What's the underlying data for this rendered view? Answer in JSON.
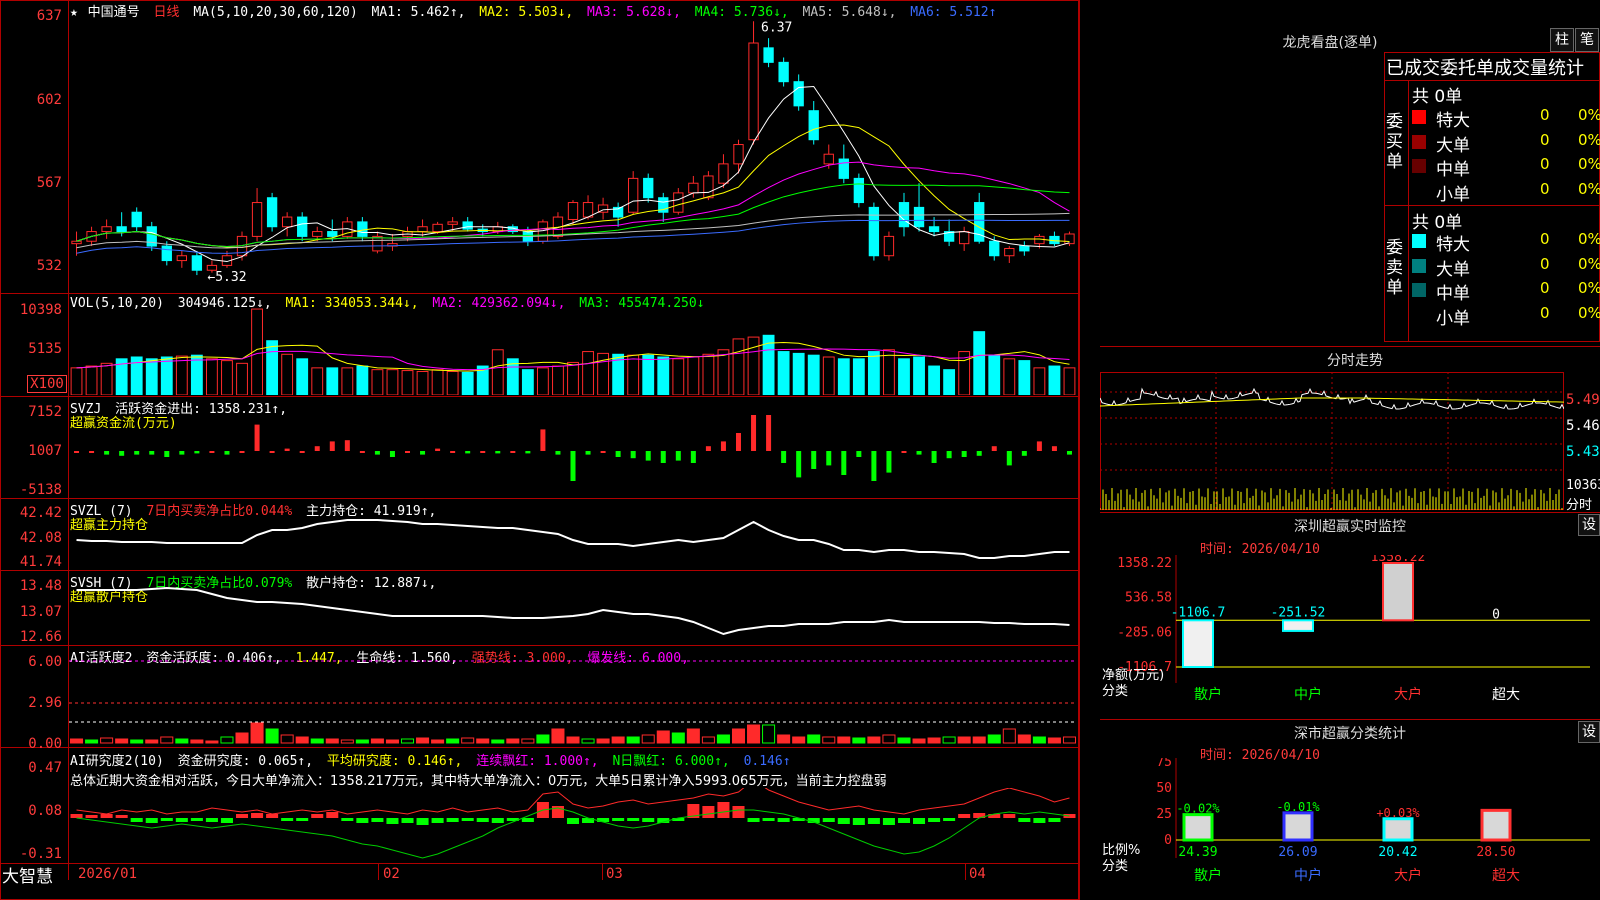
{
  "colors": {
    "up": "#ff2a2a",
    "down": "#00ffff",
    "grid": "#b00000",
    "ma1": "#ffffff",
    "ma2": "#ffff00",
    "ma3": "#ff00ff",
    "ma4": "#00ff00",
    "ma5": "#c0c0c0",
    "ma6": "#3a6bff"
  },
  "app": {
    "brand": "大智慧"
  },
  "main": {
    "star": "★",
    "title": "中国通号",
    "period": "日线",
    "ma_label": "MA(5,10,20,30,60,120)",
    "ma1": "MA1: 5.462↑,",
    "ma2": "MA2: 5.503↓,",
    "ma3": "MA3: 5.628↓,",
    "ma4": "MA4: 5.736↓,",
    "ma5": "MA5: 5.648↓,",
    "ma6": "MA6: 5.512↑",
    "y_ticks": [
      "637",
      "602",
      "567",
      "532"
    ],
    "high_mark": "6.37",
    "low_mark": "←5.32"
  },
  "vol": {
    "label": "VOL(5,10,20)",
    "val": "304946.125↓,",
    "ma1": "MA1: 334053.344↓,",
    "ma2": "MA2: 429362.094↓,",
    "ma3": "MA3: 455474.250↓",
    "y_ticks": [
      "10398",
      "5135"
    ],
    "unit": "X100"
  },
  "svzj": {
    "label": "SVZJ",
    "text": "活跃资金进出: 1358.231↑,",
    "sub": "超赢资金流(万元)",
    "y_ticks": [
      "7152",
      "1007",
      "-5138"
    ]
  },
  "svzl": {
    "label": "SVZL (7)",
    "red_text": "7日内买卖净占比0.044%",
    "text": "主力持仓: 41.919↑,",
    "sub": "超赢主力持仓",
    "y_ticks": [
      "42.42",
      "42.08",
      "41.74"
    ]
  },
  "svsh": {
    "label": "SVSH (7)",
    "green_text": "7日内买卖净占比0.079%",
    "text": "散户持仓: 12.887↓,",
    "sub": "超赢散户持仓",
    "y_ticks": [
      "13.48",
      "13.07",
      "12.66"
    ]
  },
  "ai1": {
    "label": "AI活跃度2",
    "t1": "资金活跃度: 0.406↑,",
    "t2": "1.447,",
    "t3": "生命线: 1.560,",
    "t4": "强势线: 3.000,",
    "t5": "爆发线: 6.000,",
    "y_ticks": [
      "6.00",
      "2.96",
      "0.00"
    ]
  },
  "ai2": {
    "label": "AI研究度2(10)",
    "t1": "资金研究度: 0.065↑,",
    "t2": "平均研究度: 0.146↑,",
    "t3": "连续飘红: 1.000↑,",
    "t4": "N日飘红: 6.000↑,",
    "t5": "0.146↑",
    "summary": "总体近期大资金相对活跃，今日大单净流入：1358.217万元，其中特大单净流入：0万元，大单5日累计净入5993.065万元，当前主力控盘弱",
    "y_ticks": [
      "0.47",
      "0.08",
      "-0.31"
    ]
  },
  "x_axis": [
    "2026/01",
    "02",
    "03",
    "04"
  ],
  "lhb": {
    "title": "龙虎看盘(逐单)",
    "btn1": "柱",
    "btn2": "笔",
    "header": "已成交委托单成交量统计",
    "buy": {
      "side": "委买单",
      "total": "共 0单",
      "rows": [
        {
          "name": "特大",
          "v": "0",
          "p": "0%"
        },
        {
          "name": "大单",
          "v": "0",
          "p": "0%"
        },
        {
          "name": "中单",
          "v": "0",
          "p": "0%"
        },
        {
          "name": "小单",
          "v": "0",
          "p": "0%"
        }
      ]
    },
    "sell": {
      "side": "委卖单",
      "total": "共 0单",
      "rows": [
        {
          "name": "特大",
          "v": "0",
          "p": "0%"
        },
        {
          "name": "大单",
          "v": "0",
          "p": "0%"
        },
        {
          "name": "中单",
          "v": "0",
          "p": "0%"
        },
        {
          "name": "小单",
          "v": "0",
          "p": "0%"
        }
      ]
    }
  },
  "intraday": {
    "title": "分时走势",
    "y_ticks": [
      "5.49",
      "5.46",
      "5.43"
    ],
    "vol_top": "10363",
    "vol_unit": "分时"
  },
  "monitor": {
    "title": "深圳超赢实时监控",
    "btn": "设",
    "time": "时间: 2026/04/10",
    "y_ticks": [
      "1358.22",
      "536.58",
      "-285.06",
      "-1106.7"
    ],
    "y_label": "净额(万元)",
    "x_label": "分类",
    "categories": [
      "散户",
      "中户",
      "大户",
      "超大"
    ],
    "values": [
      -1106.7,
      -251.52,
      1358.22,
      0
    ],
    "value_labels": [
      "-1106.7",
      "-251.52",
      "1358.22",
      "0"
    ]
  },
  "classify": {
    "title": "深市超赢分类统计",
    "btn": "设",
    "time": "时间: 2026/04/10",
    "y_ticks": [
      "75",
      "50",
      "25",
      "0"
    ],
    "y_label": "比例%",
    "x_label": "分类",
    "categories": [
      "散户",
      "中户",
      "大户",
      "超大"
    ],
    "values": [
      24.39,
      26.09,
      20.42,
      28.5
    ],
    "value_labels": [
      "24.39",
      "26.09",
      "20.42",
      "28.50"
    ],
    "change_labels": [
      "-0.02%",
      "-0.01%",
      "+0.03%",
      ""
    ]
  },
  "chart_data": [
    {
      "type": "candlestick",
      "title": "中国通号 日线",
      "ylim": [
        5.25,
        6.4
      ],
      "x": [
        "2026/01",
        "02",
        "03",
        "04"
      ],
      "ohlc": [
        [
          5.45,
          5.5,
          5.4,
          5.46
        ],
        [
          5.46,
          5.52,
          5.44,
          5.5
        ],
        [
          5.5,
          5.55,
          5.47,
          5.52
        ],
        [
          5.52,
          5.58,
          5.48,
          5.5
        ],
        [
          5.58,
          5.6,
          5.5,
          5.52
        ],
        [
          5.52,
          5.54,
          5.42,
          5.44
        ],
        [
          5.44,
          5.46,
          5.36,
          5.38
        ],
        [
          5.38,
          5.42,
          5.35,
          5.4
        ],
        [
          5.4,
          5.42,
          5.32,
          5.34
        ],
        [
          5.34,
          5.38,
          5.33,
          5.36
        ],
        [
          5.36,
          5.42,
          5.35,
          5.4
        ],
        [
          5.4,
          5.5,
          5.38,
          5.48
        ],
        [
          5.48,
          5.68,
          5.46,
          5.62
        ],
        [
          5.64,
          5.66,
          5.5,
          5.52
        ],
        [
          5.52,
          5.58,
          5.48,
          5.56
        ],
        [
          5.56,
          5.58,
          5.46,
          5.48
        ],
        [
          5.48,
          5.52,
          5.46,
          5.5
        ],
        [
          5.5,
          5.55,
          5.46,
          5.48
        ],
        [
          5.48,
          5.56,
          5.47,
          5.54
        ],
        [
          5.54,
          5.56,
          5.46,
          5.48
        ],
        [
          5.42,
          5.5,
          5.41,
          5.48
        ],
        [
          5.44,
          5.49,
          5.42,
          5.45
        ],
        [
          5.48,
          5.52,
          5.46,
          5.5
        ],
        [
          5.5,
          5.55,
          5.48,
          5.52
        ],
        [
          5.5,
          5.54,
          5.49,
          5.53
        ],
        [
          5.53,
          5.56,
          5.5,
          5.54
        ],
        [
          5.54,
          5.56,
          5.5,
          5.51
        ],
        [
          5.51,
          5.53,
          5.48,
          5.5
        ],
        [
          5.5,
          5.54,
          5.49,
          5.52
        ],
        [
          5.52,
          5.53,
          5.49,
          5.5
        ],
        [
          5.5,
          5.52,
          5.44,
          5.46
        ],
        [
          5.46,
          5.55,
          5.45,
          5.54
        ],
        [
          5.48,
          5.58,
          5.47,
          5.56
        ],
        [
          5.55,
          5.63,
          5.53,
          5.62
        ],
        [
          5.56,
          5.65,
          5.55,
          5.62
        ],
        [
          5.58,
          5.64,
          5.55,
          5.61
        ],
        [
          5.6,
          5.62,
          5.52,
          5.56
        ],
        [
          5.58,
          5.75,
          5.57,
          5.72
        ],
        [
          5.72,
          5.74,
          5.62,
          5.64
        ],
        [
          5.64,
          5.66,
          5.54,
          5.58
        ],
        [
          5.58,
          5.68,
          5.57,
          5.66
        ],
        [
          5.66,
          5.73,
          5.64,
          5.7
        ],
        [
          5.64,
          5.75,
          5.63,
          5.73
        ],
        [
          5.7,
          5.82,
          5.68,
          5.78
        ],
        [
          5.78,
          5.88,
          5.74,
          5.86
        ],
        [
          5.88,
          6.37,
          5.86,
          6.28
        ],
        [
          6.26,
          6.3,
          6.18,
          6.2
        ],
        [
          6.2,
          6.22,
          6.1,
          6.12
        ],
        [
          6.12,
          6.15,
          6.0,
          6.02
        ],
        [
          6.0,
          6.04,
          5.86,
          5.88
        ],
        [
          5.78,
          5.86,
          5.76,
          5.82
        ],
        [
          5.8,
          5.86,
          5.7,
          5.72
        ],
        [
          5.72,
          5.74,
          5.6,
          5.62
        ],
        [
          5.6,
          5.62,
          5.38,
          5.4
        ],
        [
          5.4,
          5.5,
          5.38,
          5.48
        ],
        [
          5.62,
          5.66,
          5.48,
          5.52
        ],
        [
          5.6,
          5.7,
          5.5,
          5.52
        ],
        [
          5.52,
          5.56,
          5.48,
          5.5
        ],
        [
          5.5,
          5.55,
          5.44,
          5.46
        ],
        [
          5.45,
          5.52,
          5.42,
          5.5
        ],
        [
          5.62,
          5.66,
          5.45,
          5.46
        ],
        [
          5.46,
          5.48,
          5.38,
          5.4
        ],
        [
          5.4,
          5.44,
          5.37,
          5.43
        ],
        [
          5.44,
          5.46,
          5.4,
          5.42
        ],
        [
          5.45,
          5.49,
          5.43,
          5.48
        ],
        [
          5.48,
          5.5,
          5.44,
          5.45
        ],
        [
          5.45,
          5.5,
          5.44,
          5.49
        ]
      ]
    }
  ]
}
